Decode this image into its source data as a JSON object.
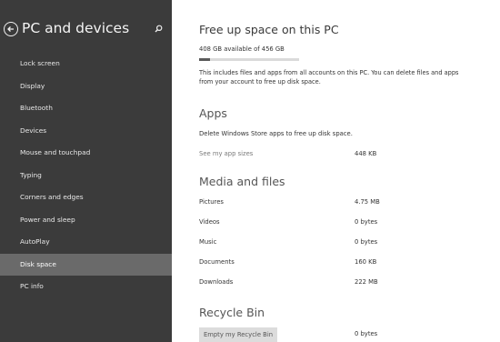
{
  "sidebar": {
    "title": "PC and devices",
    "items": [
      {
        "label": "Lock screen"
      },
      {
        "label": "Display"
      },
      {
        "label": "Bluetooth"
      },
      {
        "label": "Devices"
      },
      {
        "label": "Mouse and touchpad"
      },
      {
        "label": "Typing"
      },
      {
        "label": "Corners and edges"
      },
      {
        "label": "Power and sleep"
      },
      {
        "label": "AutoPlay"
      },
      {
        "label": "Disk space",
        "selected": true
      },
      {
        "label": "PC info"
      }
    ]
  },
  "main": {
    "title": "Free up space on this PC",
    "storage_label": "408 GB available of 456 GB",
    "used_fraction": 0.105,
    "description": "This includes files and apps from all accounts on this PC. You can delete files and apps from your account to free up disk space.",
    "apps": {
      "heading": "Apps",
      "text": "Delete Windows Store apps to free up disk space.",
      "link": "See my app sizes",
      "size": "448 KB"
    },
    "media": {
      "heading": "Media and files",
      "rows": [
        {
          "label": "Pictures",
          "value": "4.75 MB"
        },
        {
          "label": "Videos",
          "value": "0 bytes"
        },
        {
          "label": "Music",
          "value": "0 bytes"
        },
        {
          "label": "Documents",
          "value": "160 KB"
        },
        {
          "label": "Downloads",
          "value": "222 MB"
        }
      ]
    },
    "recycle": {
      "heading": "Recycle Bin",
      "button": "Empty my Recycle Bin",
      "size": "0 bytes"
    }
  },
  "colors": {
    "sidebar_bg": "#3b3b3b",
    "selected_bg": "#6a6a6a",
    "progress_fill": "#5a5a5a"
  },
  "icons": [
    "back-arrow-icon",
    "search-icon"
  ]
}
